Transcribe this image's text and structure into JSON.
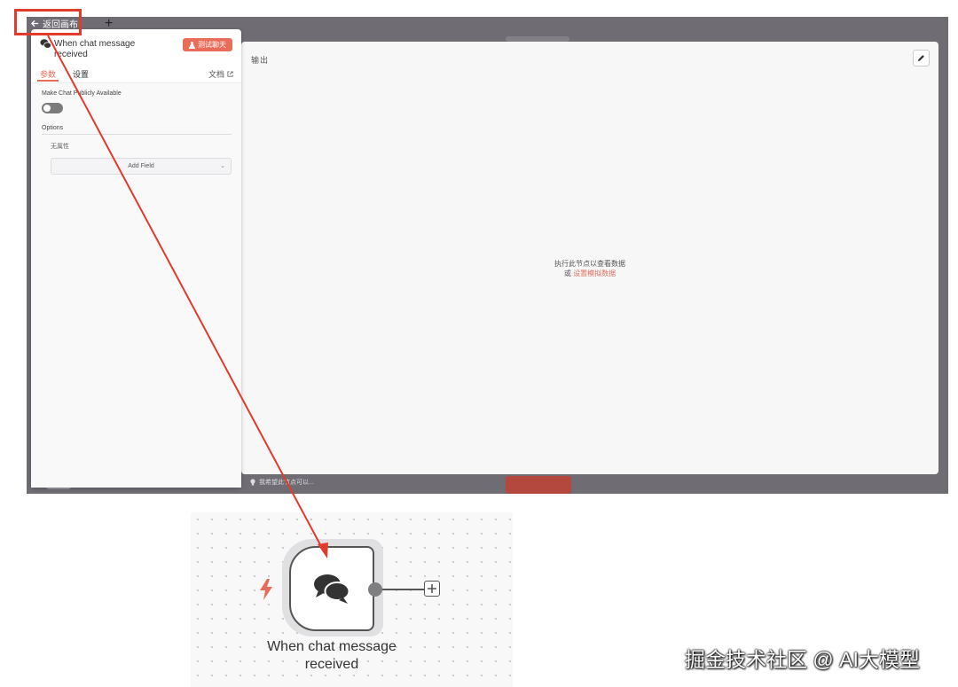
{
  "app": {
    "back_label": "返回画布"
  },
  "panel": {
    "node_title": "When chat message received",
    "test_button": "测试聊天",
    "tabs": [
      {
        "label": "参数",
        "active": true
      },
      {
        "label": "设置",
        "active": false
      }
    ],
    "docs_label": "文档",
    "public_label": "Make Chat Publicly Available",
    "public_enabled": false,
    "options_label": "Options",
    "no_properties": "无属性",
    "add_field": "Add Field"
  },
  "output": {
    "title": "输出",
    "message_line1": "执行此节点以查看数据",
    "message_or": "或",
    "mock_link": "设置模拟数据"
  },
  "hint": {
    "text": "我希望此节点可以..."
  },
  "canvas": {
    "node_label": "When chat message received"
  },
  "watermark": "掘金技术社区 @ AI大模型",
  "colors": {
    "accent": "#ea6c5a",
    "annotation_red": "#e23a2b",
    "overlay": "#6f6c74"
  }
}
